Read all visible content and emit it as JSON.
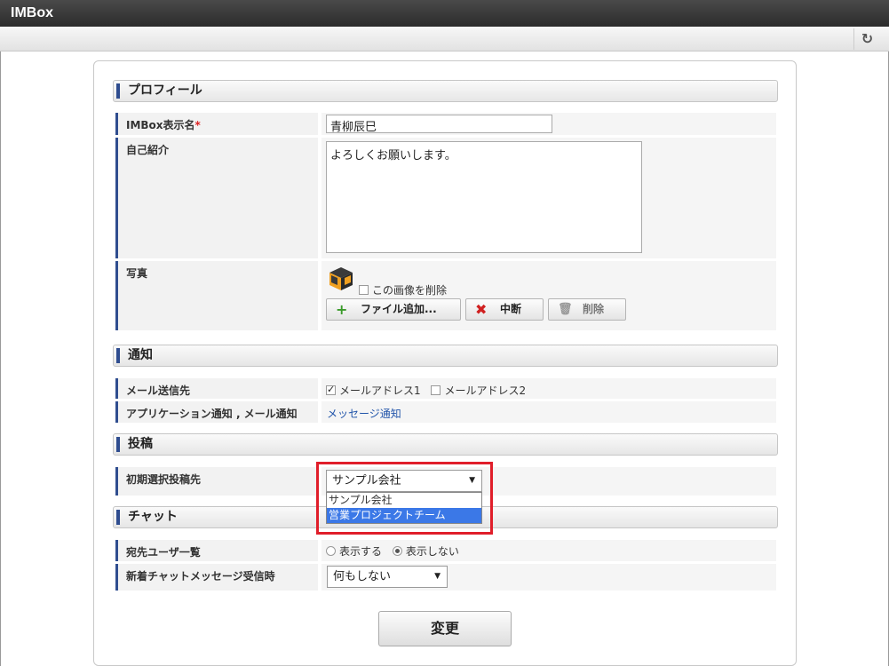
{
  "app": {
    "title": "IMBox"
  },
  "toolbar": {
    "refresh_icon": "refresh-icon"
  },
  "sections": {
    "profile": "プロフィール",
    "notification": "通知",
    "post": "投稿",
    "chat": "チャット"
  },
  "profile": {
    "display_name_label": "IMBox表示名",
    "required_mark": "*",
    "display_name_value": "青柳辰巳",
    "intro_label": "自己紹介",
    "intro_value": "よろしくお願いします。",
    "photo_label": "写真",
    "delete_image_label": "この画像を削除",
    "add_file_button": "ファイル追加...",
    "abort_button": "中断",
    "delete_button": "削除"
  },
  "notification": {
    "mail_dest_label": "メール送信先",
    "mail_address_1": "メールアドレス1",
    "mail_address_1_checked": true,
    "mail_address_2": "メールアドレス2",
    "mail_address_2_checked": false,
    "app_notify_label": "アプリケーション通知 , メール通知",
    "app_notify_link": "メッセージ通知"
  },
  "post": {
    "initial_dest_label": "初期選択投稿先",
    "selected": "サンプル会社",
    "options": [
      "サンプル会社",
      "営業プロジェクトチーム"
    ],
    "highlighted_option_index": 1
  },
  "chat": {
    "recipient_list_label": "宛先ユーザ一覧",
    "show_option": "表示する",
    "hide_option": "表示しない",
    "selected": "表示しない",
    "new_message_label": "新着チャットメッセージ受信時",
    "new_message_value": "何もしない"
  },
  "actions": {
    "submit": "変更"
  },
  "colors": {
    "accent": "#2f4d8f",
    "highlight_border": "#e01e2a",
    "link": "#2255aa",
    "selected_option": "#3b78e7"
  }
}
